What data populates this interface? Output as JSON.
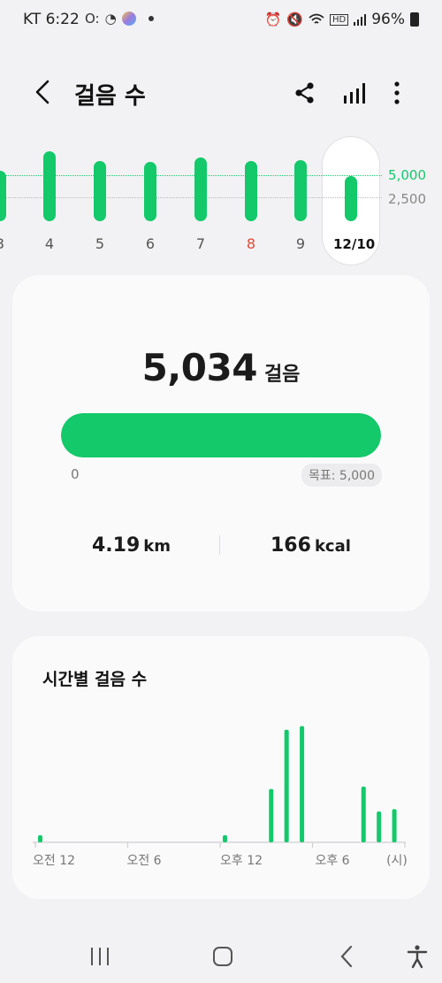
{
  "status_bar": {
    "carrier": "KT 6:22",
    "battery": "96%",
    "left_icons": [
      "oo-icon",
      "clock-arrow-icon",
      "avatar-icon",
      "dot-icon"
    ],
    "right_icons": [
      "alarm-icon",
      "mute-icon",
      "wifi-icon",
      "hd-icon",
      "signal-icon",
      "battery-icon"
    ]
  },
  "header": {
    "title": "걸음 수",
    "actions": [
      "share-icon",
      "stats-icon",
      "more-icon"
    ]
  },
  "weekly": {
    "goal_label": "5,000",
    "half_label": "2,500",
    "goal_color": "#13c96a",
    "days": [
      {
        "label": "3",
        "steps": 5600
      },
      {
        "label": "4",
        "steps": 7800
      },
      {
        "label": "5",
        "steps": 6700
      },
      {
        "label": "6",
        "steps": 6600
      },
      {
        "label": "7",
        "steps": 7100
      },
      {
        "label": "8",
        "steps": 6700,
        "color": "#e0493c"
      },
      {
        "label": "9",
        "steps": 6800
      },
      {
        "label": "12/10",
        "steps": 5034,
        "selected": true
      }
    ]
  },
  "summary": {
    "steps": "5,034",
    "steps_unit": "걸음",
    "progress_fraction": 1.0,
    "min_label": "0",
    "goal_text": "목표: 5,000",
    "distance_value": "4.19",
    "distance_unit": "km",
    "calories_value": "166",
    "calories_unit": "kcal"
  },
  "hourly": {
    "title": "시간별 걸음 수",
    "tick_labels": [
      "오전 12",
      "오전 6",
      "오후 12",
      "오후 6",
      "(시)"
    ],
    "chart_data": {
      "type": "bar",
      "x": [
        "0",
        "1",
        "2",
        "3",
        "4",
        "5",
        "6",
        "7",
        "8",
        "9",
        "10",
        "11",
        "12",
        "13",
        "14",
        "15",
        "16",
        "17",
        "18",
        "19",
        "20",
        "21",
        "22",
        "23"
      ],
      "series": [
        {
          "values": [
            60,
            0,
            0,
            0,
            0,
            0,
            0,
            0,
            0,
            0,
            0,
            0,
            60,
            0,
            0,
            450,
            950,
            980,
            0,
            0,
            0,
            470,
            260,
            280
          ]
        }
      ]
    }
  },
  "nav": {
    "buttons": [
      "recents-icon",
      "home-icon",
      "back-icon",
      "accessibility-icon"
    ]
  }
}
